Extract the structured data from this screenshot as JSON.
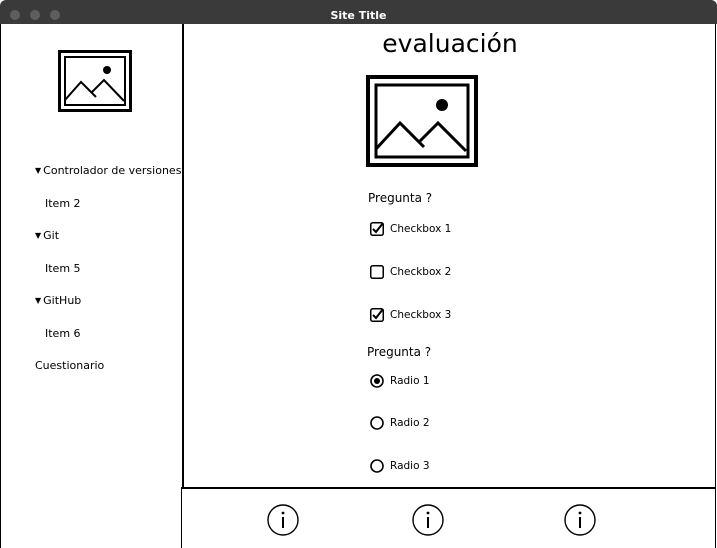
{
  "window": {
    "title": "Site Title"
  },
  "sidebar": {
    "items": [
      {
        "label": "Controlador de versiones",
        "expanded": true
      },
      {
        "label": "Item 2"
      },
      {
        "label": "Git",
        "expanded": true
      },
      {
        "label": "Item 5"
      },
      {
        "label": "GitHub",
        "expanded": true
      },
      {
        "label": "Item 6"
      },
      {
        "label": "Cuestionario"
      }
    ]
  },
  "main": {
    "title": "evaluación",
    "question1": {
      "label": "Pregunta ?",
      "options": [
        {
          "label": "Checkbox 1",
          "checked": true
        },
        {
          "label": "Checkbox 2",
          "checked": false
        },
        {
          "label": "Checkbox 3",
          "checked": true
        }
      ]
    },
    "question2": {
      "label": "Pregunta ?",
      "options": [
        {
          "label": "Radio 1",
          "selected": true
        },
        {
          "label": "Radio 2",
          "selected": false
        },
        {
          "label": "Radio 3",
          "selected": false
        }
      ]
    }
  },
  "footer": {
    "icons": [
      "info-icon",
      "info-icon",
      "info-icon"
    ]
  }
}
